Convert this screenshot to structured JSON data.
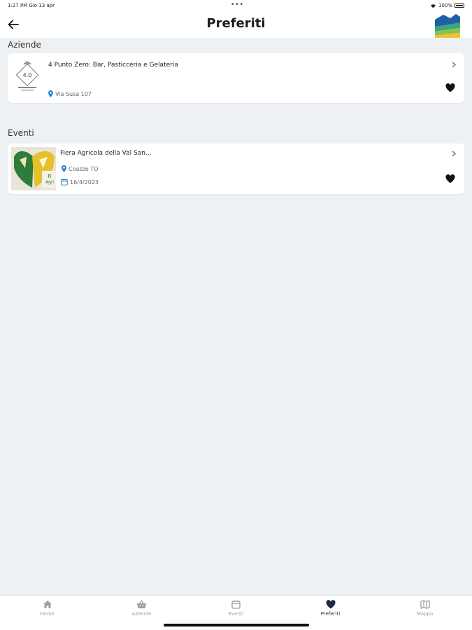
{
  "status_bar": {
    "time": "1:27 PM  Gio 13 apr",
    "battery": "100%"
  },
  "header": {
    "title": "Preferiti"
  },
  "sections": {
    "aziende": {
      "label": "Aziende",
      "items": [
        {
          "title": "4 Punto Zero: Bar, Pasticceria e Gelateria",
          "address": "Via Susa 107",
          "logo_text": "4.0"
        }
      ]
    },
    "eventi": {
      "label": "Eventi",
      "items": [
        {
          "title": "Fiera Agricola della Val San...",
          "location": "Coazze TO",
          "date": "16/4/2023"
        }
      ]
    }
  },
  "tabs": [
    {
      "label": "Home",
      "icon": "home-icon"
    },
    {
      "label": "Aziende",
      "icon": "basket-icon"
    },
    {
      "label": "Eventi",
      "icon": "calendar-icon"
    },
    {
      "label": "Preferiti",
      "icon": "heart-icon",
      "active": true
    },
    {
      "label": "Mappa",
      "icon": "map-icon"
    }
  ],
  "colors": {
    "accent": "#1d2b44",
    "background": "#eef1f4",
    "pin": "#2f7fc1"
  }
}
